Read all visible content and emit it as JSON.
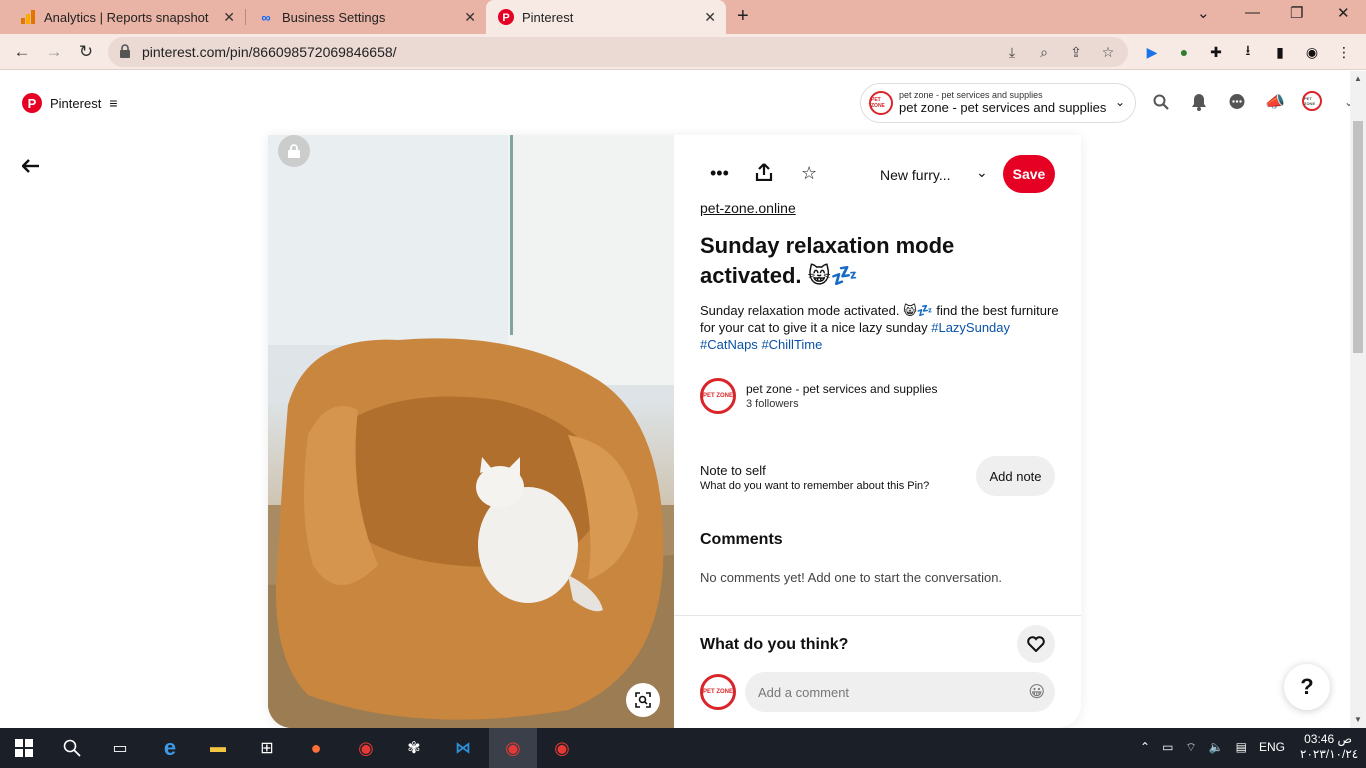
{
  "browser": {
    "tabs": [
      {
        "title": "Analytics | Reports snapshot",
        "favicon": "analytics-icon"
      },
      {
        "title": "Business Settings",
        "favicon": "meta-icon"
      },
      {
        "title": "Pinterest",
        "favicon": "pinterest-icon"
      }
    ],
    "url": "pinterest.com/pin/866098572069846658/"
  },
  "header": {
    "logo_text": "Pinterest",
    "account_small": "pet zone - pet services and supplies",
    "account_name": "pet zone - pet services and supplies",
    "avatar_text": "PET ZONE"
  },
  "pin": {
    "board": "New furry...",
    "save_label": "Save",
    "source": "pet-zone.online",
    "title": "Sunday relaxation mode activated. 😸💤",
    "desc_text": "Sunday relaxation mode activated. 😸💤 find the best furniture for your cat to give it a nice lazy sunday ",
    "hashtags": [
      "#LazySunday",
      "#CatNaps",
      "#ChillTime"
    ],
    "creator_name": "pet zone - pet services and supplies",
    "creator_followers": "3 followers",
    "note_title": "Note to self",
    "note_sub": "What do you want to remember about this Pin?",
    "add_note_label": "Add note",
    "comments_heading": "Comments",
    "no_comments": "No comments yet! Add one to start the conversation.",
    "think_heading": "What do you think?",
    "comment_placeholder": "Add a comment"
  },
  "help_label": "?",
  "taskbar": {
    "lang": "ENG",
    "time": "03:46 ص",
    "date": "٢٠٢٣/١٠/٢٤"
  },
  "colors": {
    "tab_strip": "#e9b4a5",
    "pinterest_red": "#e60023",
    "hashtag_blue": "#0a53a8"
  }
}
